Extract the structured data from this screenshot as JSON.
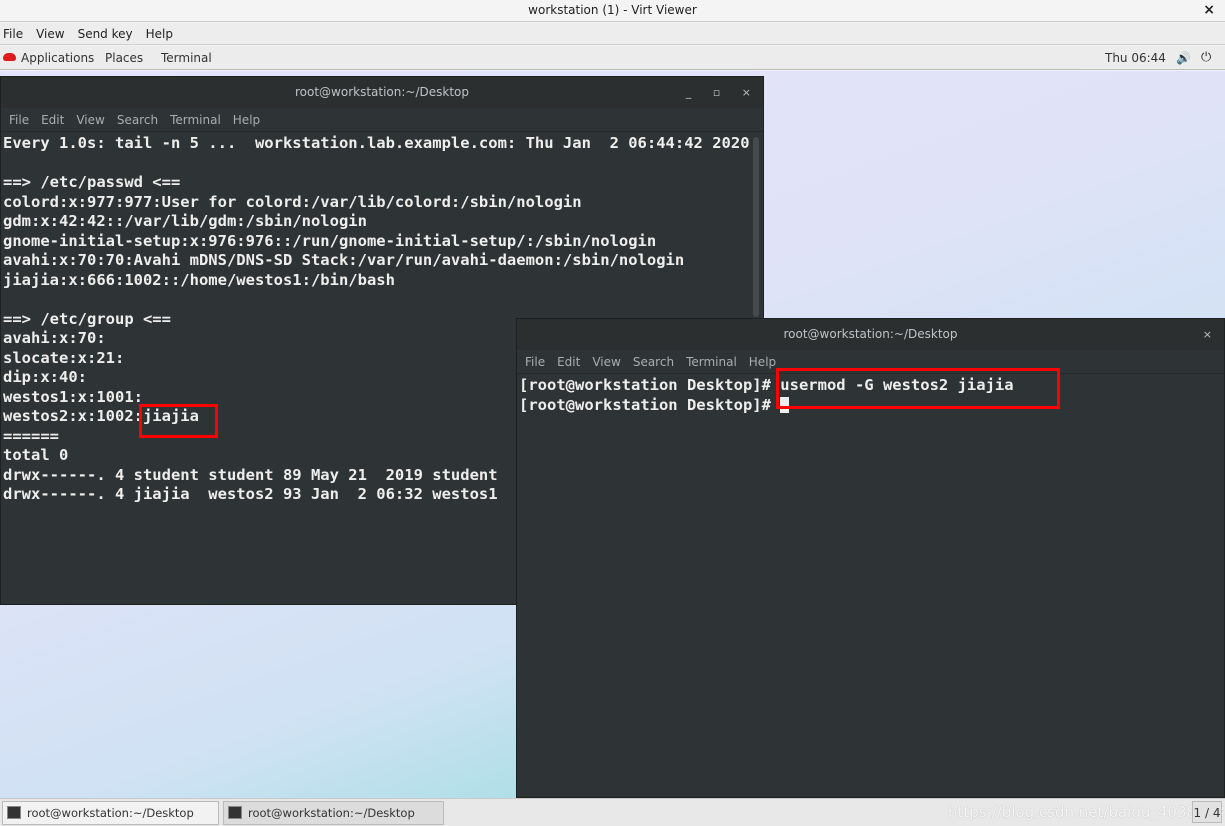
{
  "window": {
    "title": "workstation (1) - Virt Viewer",
    "close": "×"
  },
  "viewer_menu": [
    "File",
    "View",
    "Send key",
    "Help"
  ],
  "gnome_top": {
    "applications": "Applications",
    "places": "Places",
    "terminal": "Terminal",
    "clock": "Thu 06:44",
    "volume_icon": "🔊",
    "power_icon": "⏻"
  },
  "terminal1": {
    "title": "root@workstation:~/Desktop",
    "buttons": "_ ▫ ×",
    "menu": [
      "File",
      "Edit",
      "View",
      "Search",
      "Terminal",
      "Help"
    ],
    "lines": [
      "Every 1.0s: tail -n 5 ...  workstation.lab.example.com: Thu Jan  2 06:44:42 2020",
      "",
      "==> /etc/passwd <==",
      "colord:x:977:977:User for colord:/var/lib/colord:/sbin/nologin",
      "gdm:x:42:42::/var/lib/gdm:/sbin/nologin",
      "gnome-initial-setup:x:976:976::/run/gnome-initial-setup/:/sbin/nologin",
      "avahi:x:70:70:Avahi mDNS/DNS-SD Stack:/var/run/avahi-daemon:/sbin/nologin",
      "jiajia:x:666:1002::/home/westos1:/bin/bash",
      "",
      "==> /etc/group <==",
      "avahi:x:70:",
      "slocate:x:21:",
      "dip:x:40:",
      "westos1:x:1001:",
      "westos2:x:1002:jiajia",
      "======",
      "total 0",
      "drwx------. 4 student student 89 May 21  2019 student",
      "drwx------. 4 jiajia  westos2 93 Jan  2 06:32 westos1"
    ]
  },
  "terminal2": {
    "title": "root@workstation:~/Desktop",
    "buttons": "×",
    "menu": [
      "File",
      "Edit",
      "View",
      "Search",
      "Terminal",
      "Help"
    ],
    "lines": [
      "[root@workstation Desktop]# usermod -G westos2 jiajia",
      "[root@workstation Desktop]# "
    ]
  },
  "taskbar": {
    "items": [
      "root@workstation:~/Desktop",
      "root@workstation:~/Desktop"
    ],
    "watermark": "https://blog.csdn.net/baidu_40389082",
    "pager": "1 / 4"
  },
  "colors": {
    "terminal_bg": "#2e3436",
    "highlight": "#ff0000",
    "redhat": "#e01b1b"
  }
}
